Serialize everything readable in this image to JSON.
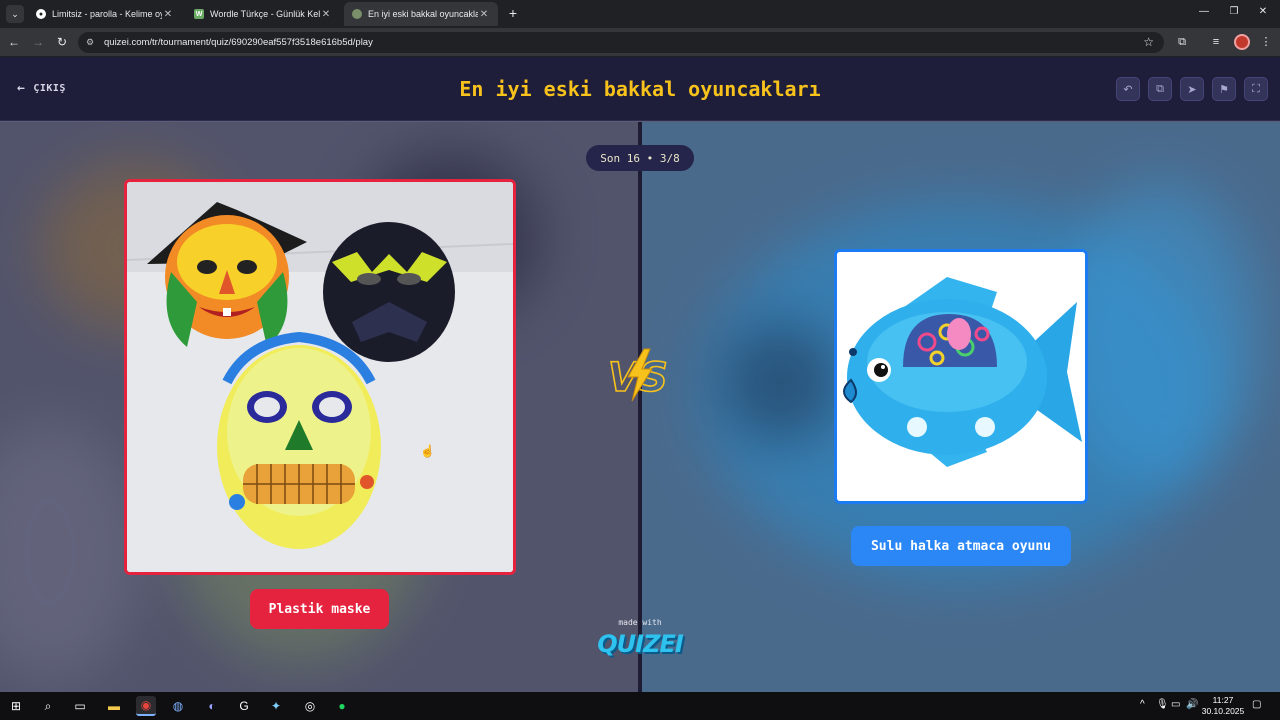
{
  "browser": {
    "tabs": [
      {
        "title": "Limitsiz - parolla - Kelime oyunu",
        "active": false
      },
      {
        "title": "Wordle Türkçe - Günlük Kelime",
        "active": false
      },
      {
        "title": "En iyi eski bakkal oyuncakları -",
        "active": true
      }
    ],
    "url": "quizei.com/tr/tournament/quiz/690290eaf557f3518e616b5d/play"
  },
  "header": {
    "exit_label": "ÇIKIŞ",
    "title": "En iyi eski bakkal oyuncakları"
  },
  "round": {
    "label": "Son 16 • 3/8"
  },
  "choices": {
    "left": {
      "name": "Plastik maske"
    },
    "right": {
      "name": "Sulu halka atmaca oyunu"
    }
  },
  "footer": {
    "made_with": "made with",
    "brand": "QUIZEI"
  },
  "taskbar": {
    "time": "11:27",
    "date": "30.10.2025"
  },
  "colors": {
    "title_yellow": "#f7c21b",
    "left_red": "#e5233e",
    "right_blue": "#2a87f5",
    "header_bg": "#1e1d3a"
  }
}
